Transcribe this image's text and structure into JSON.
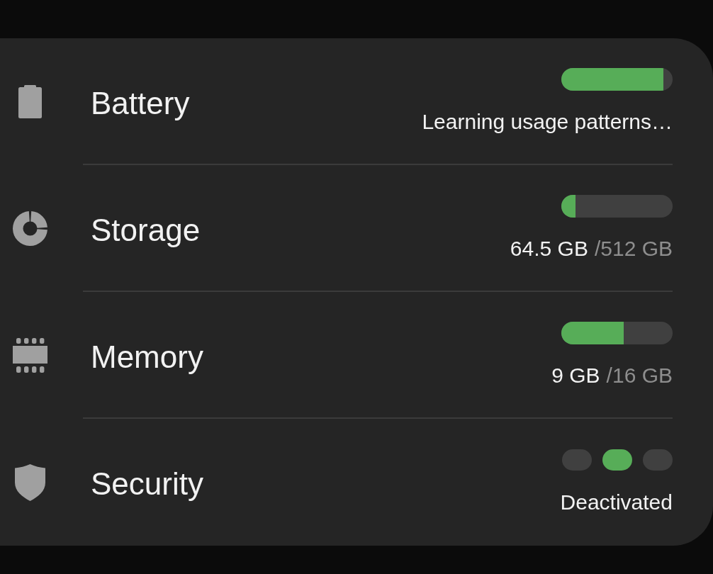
{
  "rows": [
    {
      "kind": "bar",
      "label": "Battery",
      "level": 0.92,
      "status": "Learning usage patterns…"
    },
    {
      "kind": "bar",
      "label": "Storage",
      "level": 0.126,
      "used": "64.5 GB",
      "total": "/512 GB"
    },
    {
      "kind": "bar",
      "label": "Memory",
      "level": 0.5625,
      "used": "9 GB",
      "total": "/16 GB"
    },
    {
      "kind": "segments",
      "label": "Security",
      "segments": [
        {
          "selected": false
        },
        {
          "selected": true
        },
        {
          "selected": false
        }
      ],
      "status": "Deactivated"
    }
  ]
}
